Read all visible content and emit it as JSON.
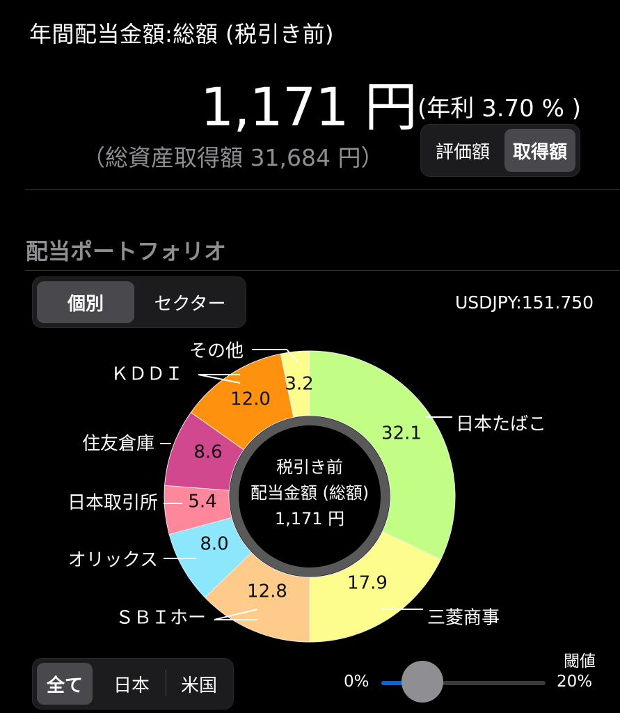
{
  "summary": {
    "title": "年間配当金額:総額 (税引き前)",
    "total": "1,171 円",
    "rate": "(年利 3.70 % )",
    "cost": "（総資産取得額 31,684 円）"
  },
  "basis_toggle": {
    "options": [
      "評価額",
      "取得額"
    ],
    "selected": 1
  },
  "portfolio": {
    "section_title": "配当ポートフォリオ",
    "view_toggle": {
      "options": [
        "個別",
        "セクター"
      ],
      "selected": 0
    },
    "fx_rate": "USDJPY:151.750"
  },
  "chart_data": {
    "type": "pie",
    "donut": true,
    "center_label": [
      "税引き前",
      "配当金額 (総額)",
      "1,171 円"
    ],
    "slices": [
      {
        "label": "日本たばこ",
        "value": 32.1,
        "value_label": "32.1",
        "color": "#c2fe85"
      },
      {
        "label": "三菱商事",
        "value": 17.9,
        "value_label": "17.9",
        "color": "#fdfd8d"
      },
      {
        "label": "ＳＢＩホー",
        "value": 12.8,
        "value_label": "12.8",
        "color": "#ffcb8a"
      },
      {
        "label": "オリックス",
        "value": 8.0,
        "value_label": "8.0",
        "color": "#8ce6fc"
      },
      {
        "label": "日本取引所",
        "value": 5.4,
        "value_label": "5.4",
        "color": "#fe879b"
      },
      {
        "label": "住友倉庫",
        "value": 8.6,
        "value_label": "8.6",
        "color": "#d1488e"
      },
      {
        "label": "ＫＤＤＩ",
        "value": 12.0,
        "value_label": "12.0",
        "color": "#fe920f"
      },
      {
        "label": "その他",
        "value": 3.2,
        "value_label": "3.2",
        "color": "#fdfd8d"
      }
    ]
  },
  "threshold": {
    "title": "閾値",
    "min_label": "0%",
    "max_label": "20%",
    "value": 0.25
  },
  "market_toggle": {
    "options": [
      "全て",
      "日本",
      "米国"
    ],
    "selected": 0
  }
}
